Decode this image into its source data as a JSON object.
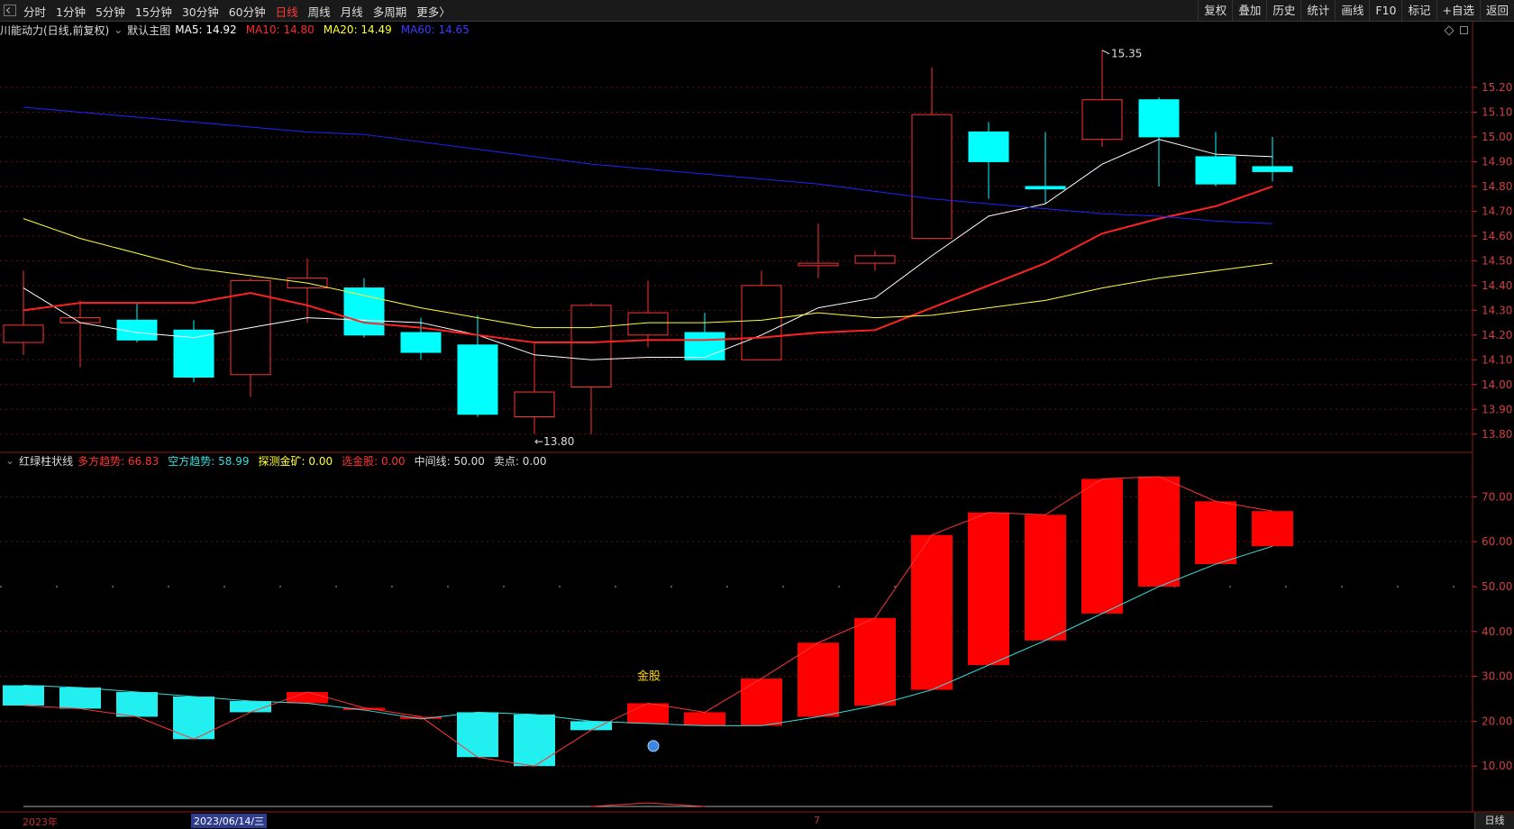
{
  "toolbar": {
    "periods": [
      "分时",
      "1分钟",
      "5分钟",
      "15分钟",
      "30分钟",
      "60分钟",
      "日线",
      "周线",
      "月线",
      "多周期",
      "更多〉"
    ],
    "active_period": "日线",
    "right_buttons": [
      "复权",
      "叠加",
      "历史",
      "统计",
      "画线",
      "F10",
      "标记",
      "+自选",
      "返回"
    ]
  },
  "main_legend": {
    "title": "川能动力(日线,前复权)",
    "template": "默认主图",
    "items": [
      {
        "label": "MA5: 14.92",
        "color": "#ffffff"
      },
      {
        "label": "MA10: 14.80",
        "color": "#ff2a2a"
      },
      {
        "label": "MA20: 14.49",
        "color": "#ffff33"
      },
      {
        "label": "MA60: 14.65",
        "color": "#3b3bff"
      }
    ]
  },
  "indicator_legend": {
    "title": "红绿柱状线",
    "items": [
      {
        "label": "多方趋势: 66.83",
        "color": "#ff3333"
      },
      {
        "label": "空方趋势: 58.99",
        "color": "#33dddd"
      },
      {
        "label": "探测金矿: 0.00",
        "color": "#ffff33"
      },
      {
        "label": "选金股: 0.00",
        "color": "#ff3333"
      },
      {
        "label": "中间线: 50.00",
        "color": "#dddddd"
      },
      {
        "label": "卖点: 0.00",
        "color": "#dddddd"
      }
    ]
  },
  "colors": {
    "up": "#ff3333",
    "down": "#00ffff",
    "ma5": "#ffffff",
    "ma10": "#ff2222",
    "ma20": "#ffff33",
    "ma60": "#2222ff",
    "bear_line": "#33dddd"
  },
  "chart_data": [
    {
      "type": "candlestick",
      "title": "川能动力(日线,前复权)",
      "y_ticks": [
        "15.20",
        "15.10",
        "15.00",
        "14.90",
        "14.80",
        "14.70",
        "14.60",
        "14.50",
        "14.40",
        "14.30",
        "14.20",
        "14.10",
        "14.00",
        "13.90",
        "13.80"
      ],
      "ylim": [
        13.77,
        15.4
      ],
      "candles": [
        {
          "o": 14.17,
          "c": 14.24,
          "h": 14.46,
          "l": 14.12
        },
        {
          "o": 14.25,
          "c": 14.27,
          "h": 14.34,
          "l": 14.07
        },
        {
          "o": 14.26,
          "c": 14.18,
          "h": 14.33,
          "l": 14.17
        },
        {
          "o": 14.22,
          "c": 14.03,
          "h": 14.26,
          "l": 14.01
        },
        {
          "o": 14.04,
          "c": 14.42,
          "h": 14.43,
          "l": 13.95
        },
        {
          "o": 14.39,
          "c": 14.43,
          "h": 14.51,
          "l": 14.25
        },
        {
          "o": 14.39,
          "c": 14.2,
          "h": 14.43,
          "l": 14.19
        },
        {
          "o": 14.21,
          "c": 14.13,
          "h": 14.27,
          "l": 14.1
        },
        {
          "o": 14.16,
          "c": 13.88,
          "h": 14.28,
          "l": 13.87
        },
        {
          "o": 13.87,
          "c": 13.97,
          "h": 14.17,
          "l": 13.8
        },
        {
          "o": 13.99,
          "c": 14.32,
          "h": 14.33,
          "l": 13.8
        },
        {
          "o": 14.2,
          "c": 14.29,
          "h": 14.42,
          "l": 14.15
        },
        {
          "o": 14.21,
          "c": 14.1,
          "h": 14.29,
          "l": 14.1
        },
        {
          "o": 14.1,
          "c": 14.4,
          "h": 14.46,
          "l": 14.1
        },
        {
          "o": 14.48,
          "c": 14.49,
          "h": 14.65,
          "l": 14.43
        },
        {
          "o": 14.49,
          "c": 14.52,
          "h": 14.54,
          "l": 14.46
        },
        {
          "o": 14.59,
          "c": 15.09,
          "h": 15.28,
          "l": 14.59
        },
        {
          "o": 15.02,
          "c": 14.9,
          "h": 15.06,
          "l": 14.75
        },
        {
          "o": 14.8,
          "c": 14.79,
          "h": 15.02,
          "l": 14.73
        },
        {
          "o": 14.99,
          "c": 15.15,
          "h": 15.35,
          "l": 14.96
        },
        {
          "o": 15.15,
          "c": 15.0,
          "h": 15.16,
          "l": 14.8
        },
        {
          "o": 14.92,
          "c": 14.81,
          "h": 15.02,
          "l": 14.8
        },
        {
          "o": 14.88,
          "c": 14.86,
          "h": 15.0,
          "l": 14.82
        }
      ],
      "ma": {
        "MA5": [
          14.39,
          14.25,
          14.21,
          14.19,
          14.23,
          14.27,
          14.26,
          14.25,
          14.2,
          14.12,
          14.1,
          14.11,
          14.11,
          14.2,
          14.31,
          14.35,
          14.52,
          14.68,
          14.73,
          14.89,
          14.99,
          14.93,
          14.92
        ],
        "MA10": [
          14.3,
          14.33,
          14.33,
          14.33,
          14.37,
          14.32,
          14.25,
          14.23,
          14.2,
          14.17,
          14.17,
          14.18,
          14.18,
          14.19,
          14.21,
          14.22,
          14.31,
          14.4,
          14.49,
          14.61,
          14.67,
          14.72,
          14.8
        ],
        "MA20": [
          14.67,
          14.59,
          14.53,
          14.47,
          14.44,
          14.41,
          14.36,
          14.31,
          14.27,
          14.23,
          14.23,
          14.25,
          14.25,
          14.26,
          14.29,
          14.27,
          14.28,
          14.31,
          14.34,
          14.39,
          14.43,
          14.46,
          14.49
        ],
        "MA60": [
          15.12,
          15.1,
          15.08,
          15.06,
          15.04,
          15.02,
          15.01,
          14.98,
          14.95,
          14.92,
          14.89,
          14.87,
          14.85,
          14.83,
          14.81,
          14.78,
          14.75,
          14.73,
          14.71,
          14.69,
          14.68,
          14.66,
          14.65
        ]
      },
      "high_label": "15.35",
      "low_label": "←13.80"
    },
    {
      "type": "bar",
      "title": "红绿柱状线",
      "y_ticks": [
        "70.00",
        "60.00",
        "50.00",
        "40.00",
        "30.00",
        "20.00",
        "10.00"
      ],
      "ylim": [
        0,
        76.3
      ],
      "series": [
        {
          "name": "多方趋势",
          "values": [
            23.5,
            22.8,
            21.0,
            16.0,
            22.0,
            26.5,
            23.0,
            21.0,
            12.0,
            10.0,
            18.0,
            24.0,
            22.0,
            29.5,
            37.5,
            43.0,
            61.5,
            66.5,
            66.0,
            74.0,
            74.5,
            69.0,
            66.83
          ]
        },
        {
          "name": "空方趋势",
          "values": [
            28.0,
            27.5,
            26.5,
            25.5,
            24.5,
            24.0,
            22.5,
            20.5,
            22.0,
            21.5,
            20.0,
            19.5,
            19.0,
            19.0,
            21.0,
            23.5,
            27.0,
            32.5,
            38.0,
            44.0,
            50.0,
            55.0,
            58.99
          ]
        }
      ],
      "annotation": "金股",
      "annotation_index": 11
    }
  ],
  "bottom": {
    "date_left": "2023年",
    "date_cursor": "2023/06/14/三",
    "date_mark": "7",
    "period": "日线"
  }
}
